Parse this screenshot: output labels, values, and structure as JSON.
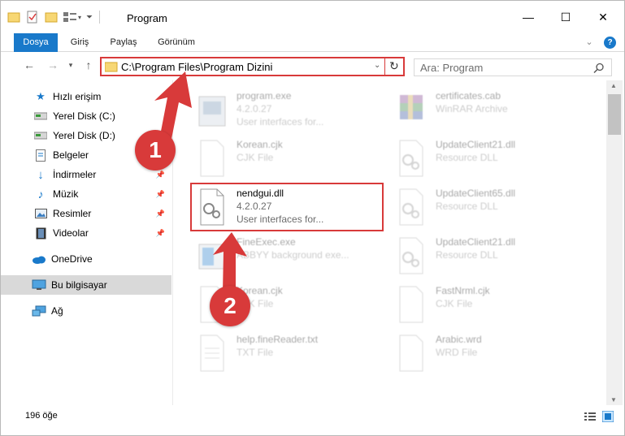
{
  "window": {
    "title": "Program",
    "controls": {
      "minimize": "—",
      "maximize": "☐",
      "close": "✕"
    }
  },
  "ribbon": {
    "tabs": [
      "Dosya",
      "Giriş",
      "Paylaş",
      "Görünüm"
    ],
    "help": "?"
  },
  "address": {
    "path": "C:\\Program Files\\Program Dizini",
    "search_placeholder": "Ara: Program"
  },
  "navigation": {
    "quick_access": "Hızlı erişim",
    "items": [
      {
        "label": "Yerel Disk (C:)",
        "icon": "drive-icon",
        "pinned": false
      },
      {
        "label": "Yerel Disk (D:)",
        "icon": "drive-icon",
        "pinned": false
      },
      {
        "label": "Belgeler",
        "icon": "document-icon",
        "pinned": true
      },
      {
        "label": "İndirmeler",
        "icon": "download-icon",
        "pinned": true
      },
      {
        "label": "Müzik",
        "icon": "music-icon",
        "pinned": true
      },
      {
        "label": "Resimler",
        "icon": "pictures-icon",
        "pinned": true
      },
      {
        "label": "Videolar",
        "icon": "video-icon",
        "pinned": true
      }
    ],
    "onedrive": "OneDrive",
    "this_pc": "Bu bilgisayar",
    "network": "Ağ"
  },
  "files": [
    {
      "name": "program.exe",
      "line2": "4.2.0.27",
      "line3": "User interfaces for...",
      "icon": "exe-icon"
    },
    {
      "name": "certificates.cab",
      "line2": "WinRAR Archive",
      "icon": "archive-icon"
    },
    {
      "name": "Korean.cjk",
      "line2": "CJK File",
      "icon": "file-icon"
    },
    {
      "name": "UpdateClient21.dll",
      "line2": "Resource DLL",
      "icon": "dll-icon"
    },
    {
      "name": "nendgui.dll",
      "line2": "4.2.0.27",
      "line3": "User interfaces for...",
      "icon": "dll-icon"
    },
    {
      "name": "UpdateClient65.dll",
      "line2": "Resource DLL",
      "icon": "dll-icon"
    },
    {
      "name": "FineExec.exe",
      "line2": "ABBYY background exe...",
      "icon": "exe-icon"
    },
    {
      "name": "UpdateClient21.dll",
      "line2": "Resource DLL",
      "icon": "dll-icon"
    },
    {
      "name": "Korean.cjk",
      "line2": "CJK File",
      "icon": "file-icon"
    },
    {
      "name": "FastNrml.cjk",
      "line2": "CJK File",
      "icon": "file-icon"
    },
    {
      "name": "help.fineReader.txt",
      "line2": "TXT File",
      "icon": "text-icon"
    },
    {
      "name": "Arabic.wrd",
      "line2": "WRD File",
      "icon": "file-icon"
    }
  ],
  "status": {
    "count": "196 öğe"
  },
  "annotations": {
    "step1": "1",
    "step2": "2",
    "color": "#d83a3a"
  }
}
